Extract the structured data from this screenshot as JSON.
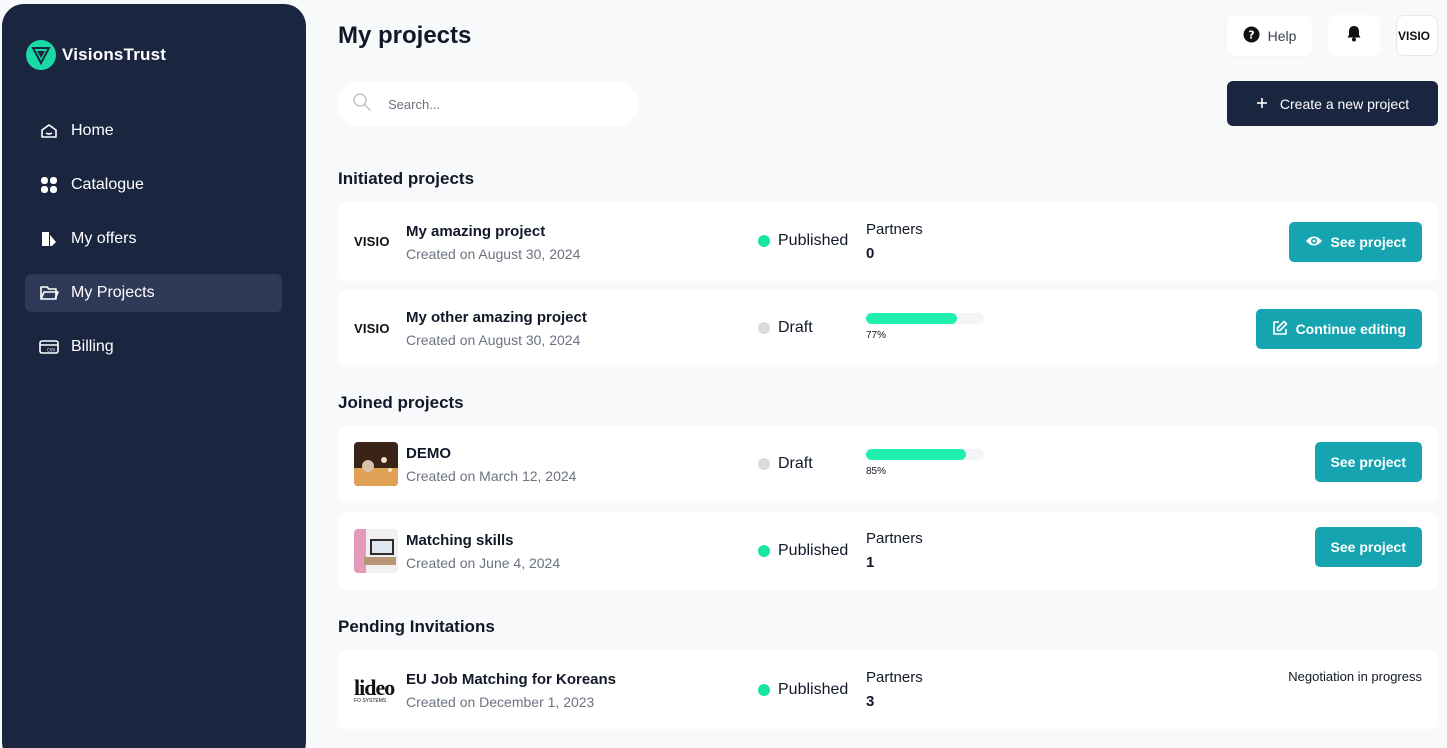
{
  "brand": {
    "name": "VisionsTrust",
    "accent": "#19d9a5"
  },
  "sidebar": {
    "items": [
      {
        "label": "Home",
        "icon": "home-icon",
        "active": false
      },
      {
        "label": "Catalogue",
        "icon": "grid-icon",
        "active": false
      },
      {
        "label": "My offers",
        "icon": "offers-icon",
        "active": false
      },
      {
        "label": "My Projects",
        "icon": "folder-icon",
        "active": true
      },
      {
        "label": "Billing",
        "icon": "billing-icon",
        "active": false
      }
    ]
  },
  "header": {
    "title": "My projects",
    "help_label": "Help",
    "avatar_text": "VISIO",
    "search_placeholder": "Search...",
    "create_label": "Create a new project"
  },
  "initiated": {
    "title": "Initiated projects",
    "projects": [
      {
        "logo_text": "VISIO",
        "name": "My amazing project",
        "date": "Created on August 30, 2024",
        "status": "Published",
        "partners_label": "Partners",
        "partners": "0",
        "action": "See project"
      },
      {
        "logo_text": "VISIO",
        "name": "My other amazing project",
        "date": "Created on August 30, 2024",
        "status": "Draft",
        "progress": 0.77,
        "progress_text": "77%",
        "action": "Continue editing"
      }
    ]
  },
  "joined": {
    "title": "Joined projects",
    "projects": [
      {
        "name": "DEMO",
        "date": "Created on March 12, 2024",
        "status": "Draft",
        "progress": 0.85,
        "progress_text": "85%",
        "action": "See project"
      },
      {
        "name": "Matching skills",
        "date": "Created on June 4, 2024",
        "status": "Published",
        "partners_label": "Partners",
        "partners": "1",
        "action": "See project"
      }
    ]
  },
  "pending": {
    "title": "Pending Invitations",
    "projects": [
      {
        "logo_text": "lideo",
        "logo_sub": "FO SYSTEMS",
        "name": "EU Job Matching for Koreans",
        "date": "Created on December 1, 2023",
        "status": "Published",
        "partners_label": "Partners",
        "partners": "3",
        "note": "Negotiation in progress"
      }
    ]
  },
  "colors": {
    "sidebar": "#1a2540",
    "teal_button": "#15a4b0",
    "published": "#19e6a3",
    "draft": "#d9dbdf",
    "progress": "#1ff0b0"
  }
}
